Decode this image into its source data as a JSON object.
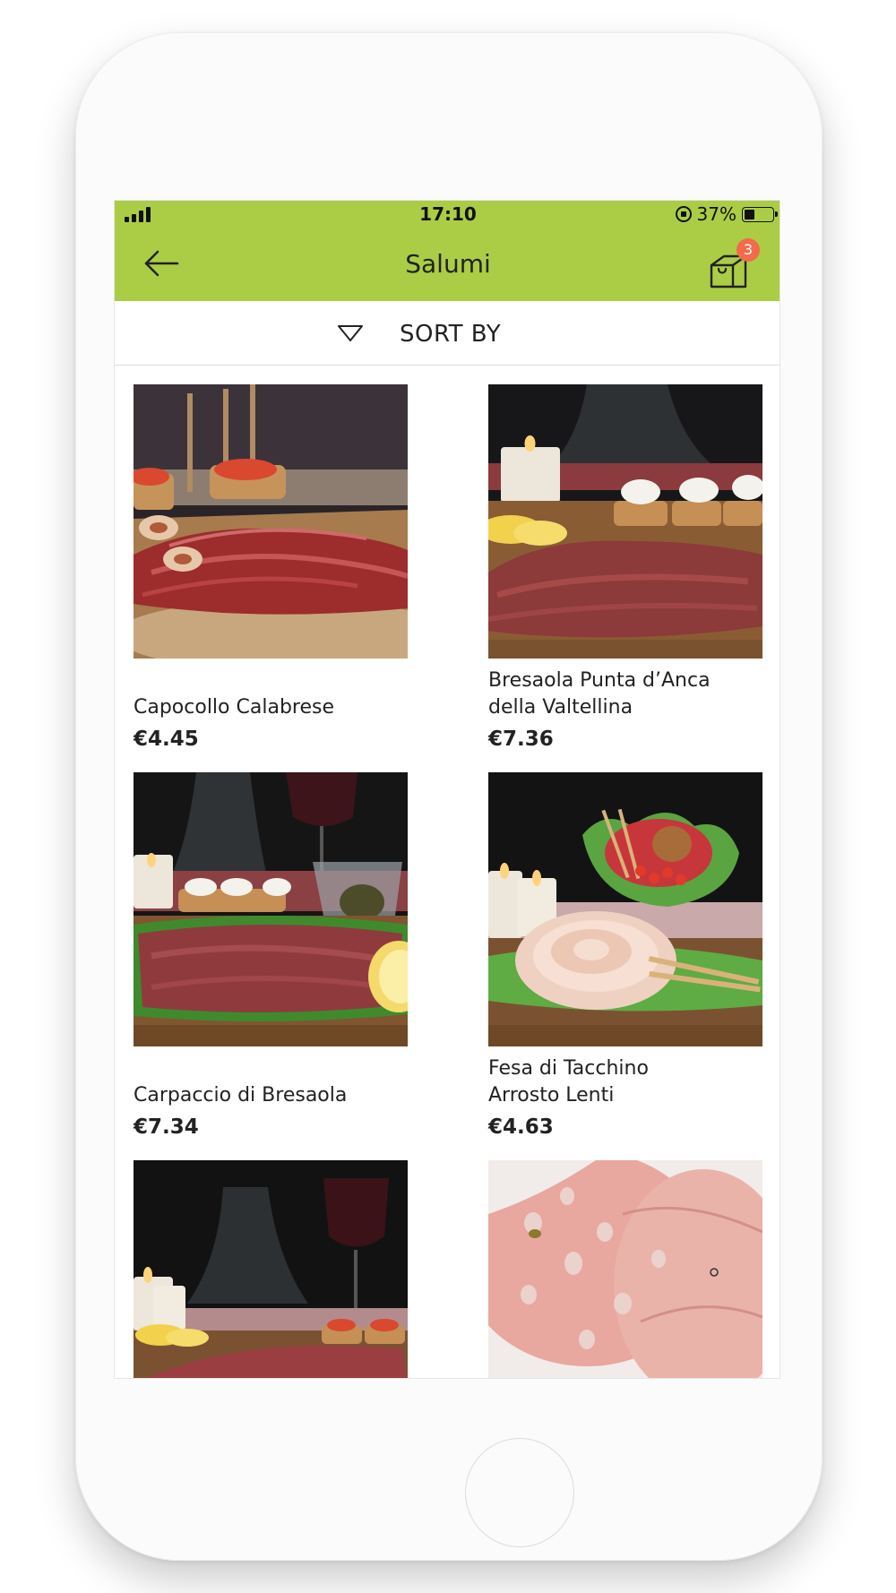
{
  "status_bar": {
    "time": "17:10",
    "battery": "37%"
  },
  "header": {
    "title": "Salumi",
    "cart_count": "3",
    "accent_color": "#abcd45",
    "badge_color": "#f26b4d"
  },
  "sort": {
    "label": "SORT BY"
  },
  "products": [
    {
      "name": "Capocollo Calabrese",
      "price": "€4.45",
      "image": "capocollo-photo"
    },
    {
      "name": "Bresaola Punta d’Anca\ndella Valtellina",
      "price": "€7.36",
      "image": "bresaola-photo"
    },
    {
      "name": "Carpaccio di Bresaola",
      "price": "€7.34",
      "image": "carpaccio-photo"
    },
    {
      "name": "Fesa di Tacchino\nArrosto Lenti",
      "price": "€4.63",
      "image": "turkey-photo"
    },
    {
      "name": "",
      "price": "",
      "image": "beef-slices-photo"
    },
    {
      "name": "",
      "price": "",
      "image": "mortadella-photo"
    }
  ]
}
